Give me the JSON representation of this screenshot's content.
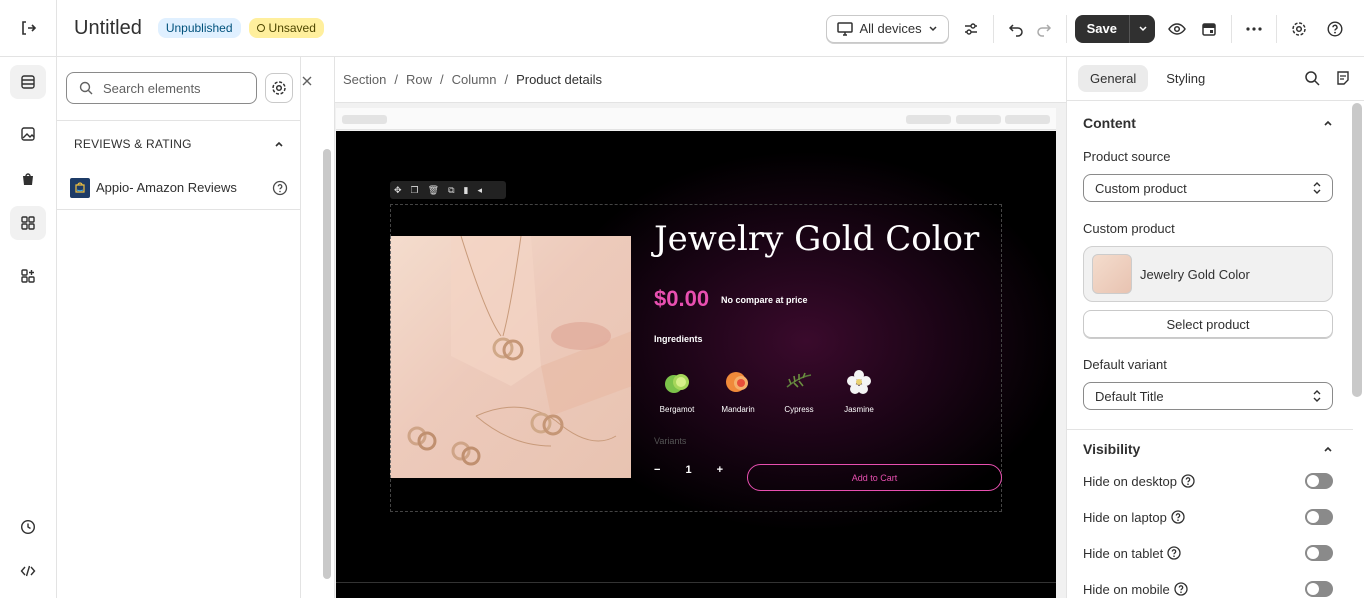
{
  "header": {
    "title": "Untitled",
    "status_published": "Unpublished",
    "status_saved": "Unsaved",
    "device_selector": "All devices",
    "save_label": "Save"
  },
  "elements_panel": {
    "search_placeholder": "Search elements",
    "section_title": "REVIEWS & RATING",
    "app_name": "Appio- Amazon Reviews"
  },
  "breadcrumb": [
    "Section",
    "Row",
    "Column",
    "Product details"
  ],
  "product": {
    "title": "Jewelry Gold Color",
    "price": "$0.00",
    "compare_text": "No compare at price",
    "ingredients_heading": "Ingredients",
    "ingredients": [
      "Bergamot",
      "Mandarin",
      "Cypress",
      "Jasmine"
    ],
    "variant_label": "Variants",
    "quantity": "1",
    "add_to_cart": "Add to Cart"
  },
  "right_panel": {
    "tabs": [
      "General",
      "Styling"
    ],
    "content_heading": "Content",
    "product_source_label": "Product source",
    "product_source_value": "Custom product",
    "custom_product_label": "Custom product",
    "custom_product_name": "Jewelry Gold Color",
    "select_product_button": "Select product",
    "default_variant_label": "Default variant",
    "default_variant_value": "Default Title",
    "visibility_heading": "Visibility",
    "visibility_toggles": [
      "Hide on desktop",
      "Hide on laptop",
      "Hide on tablet",
      "Hide on mobile"
    ]
  },
  "colors": {
    "accent_pink": "#e84fb0",
    "save_bg": "#303030",
    "badge_info": "#e0f0ff",
    "badge_warning": "#ffef9d"
  }
}
